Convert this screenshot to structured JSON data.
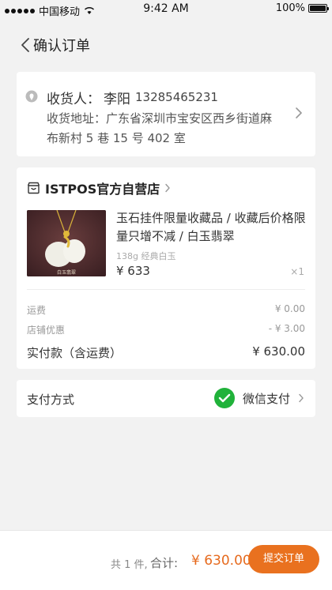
{
  "status_bar": {
    "carrier": "中国移动",
    "time": "9:42 AM",
    "battery": "100%"
  },
  "nav": {
    "title": "确认订单"
  },
  "address": {
    "receiver_label": "收货人：",
    "receiver_name": "李阳",
    "phone": "13285465231",
    "address_text": "收货地址：广东省深圳市宝安区西乡街道麻布新村 5 巷 15 号 402 室"
  },
  "store": {
    "name": "ISTPOS官方自营店",
    "product": {
      "title": "玉石挂件限量收藏品 / 收藏后价格限量只增不减 / 白玉翡翠",
      "image_caption": "白玉翡翠",
      "spec": "138g 经典白玉",
      "price": "¥ 633",
      "quantity": "×1"
    },
    "fees": [
      {
        "label": "运费",
        "value": "¥ 0.00"
      },
      {
        "label": "店铺优惠",
        "value": "- ¥ 3.00"
      }
    ],
    "actual": {
      "label": "实付款（含运费）",
      "value": "¥ 630.00"
    }
  },
  "payment": {
    "label": "支付方式",
    "method": "微信支付"
  },
  "footer": {
    "count": "共 1 件,",
    "total_label": "合计:",
    "total_amount": "¥ 630.00",
    "submit_label": "提交订单"
  },
  "colors": {
    "accent": "#e9711f",
    "wechat": "#20b23a"
  }
}
